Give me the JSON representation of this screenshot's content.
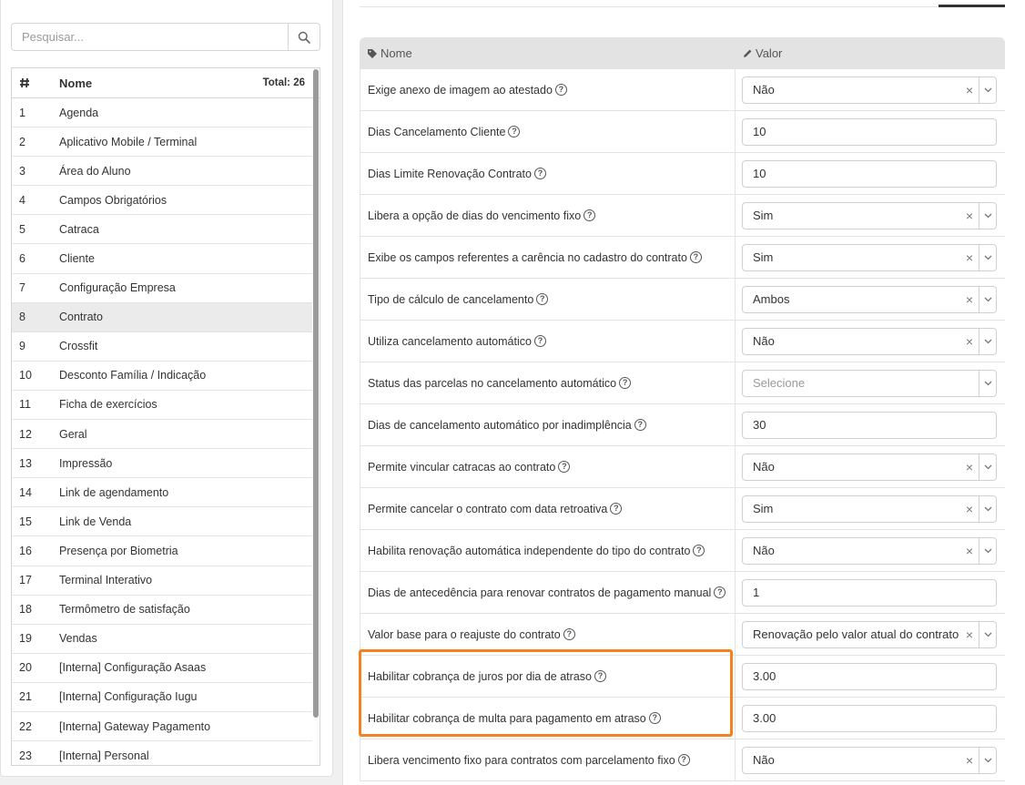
{
  "search": {
    "placeholder": "Pesquisar..."
  },
  "list": {
    "header_hash": "#",
    "header_name": "Nome",
    "total": "Total: 26",
    "items": [
      {
        "num": "1",
        "name": "Agenda"
      },
      {
        "num": "2",
        "name": "Aplicativo Mobile / Terminal"
      },
      {
        "num": "3",
        "name": "Área do Aluno"
      },
      {
        "num": "4",
        "name": "Campos Obrigatórios"
      },
      {
        "num": "5",
        "name": "Catraca"
      },
      {
        "num": "6",
        "name": "Cliente"
      },
      {
        "num": "7",
        "name": "Configuração Empresa"
      },
      {
        "num": "8",
        "name": "Contrato"
      },
      {
        "num": "9",
        "name": "Crossfit"
      },
      {
        "num": "10",
        "name": "Desconto Família / Indicação"
      },
      {
        "num": "11",
        "name": "Ficha de exercícios"
      },
      {
        "num": "12",
        "name": "Geral"
      },
      {
        "num": "13",
        "name": "Impressão"
      },
      {
        "num": "14",
        "name": "Link de agendamento"
      },
      {
        "num": "15",
        "name": "Link de Venda"
      },
      {
        "num": "16",
        "name": "Presença por Biometria"
      },
      {
        "num": "17",
        "name": "Terminal Interativo"
      },
      {
        "num": "18",
        "name": "Termômetro de satisfação"
      },
      {
        "num": "19",
        "name": "Vendas"
      },
      {
        "num": "20",
        "name": "[Interna] Configuração Asaas"
      },
      {
        "num": "21",
        "name": "[Interna] Configuração Iugu"
      },
      {
        "num": "22",
        "name": "[Interna] Gateway Pagamento"
      },
      {
        "num": "23",
        "name": "[Interna] Personal"
      }
    ],
    "selected_index": 7
  },
  "config": {
    "header_name": "Nome",
    "header_value": "Valor",
    "help_glyph": "?",
    "rows": [
      {
        "label": "Exige anexo de imagem ao atestado",
        "type": "select",
        "value": "Não"
      },
      {
        "label": "Dias Cancelamento Cliente",
        "type": "input",
        "value": "10"
      },
      {
        "label": "Dias Limite Renovação Contrato",
        "type": "input",
        "value": "10"
      },
      {
        "label": "Libera a opção de dias do vencimento fixo",
        "type": "select",
        "value": "Sim"
      },
      {
        "label": "Exibe os campos referentes a carência no cadastro do contrato",
        "type": "select",
        "value": "Sim"
      },
      {
        "label": "Tipo de cálculo de cancelamento",
        "type": "select",
        "value": "Ambos"
      },
      {
        "label": "Utiliza cancelamento automático",
        "type": "select",
        "value": "Não"
      },
      {
        "label": "Status das parcelas no cancelamento automático",
        "type": "select-empty",
        "value": "Selecione"
      },
      {
        "label": "Dias de cancelamento automático por inadimplência",
        "type": "input",
        "value": "30"
      },
      {
        "label": "Permite vincular catracas ao contrato",
        "type": "select",
        "value": "Não"
      },
      {
        "label": "Permite cancelar o contrato com data retroativa",
        "type": "select",
        "value": "Sim"
      },
      {
        "label": "Habilita renovação automática independente do tipo do contrato",
        "type": "select",
        "value": "Não"
      },
      {
        "label": "Dias de antecedência para renovar contratos de pagamento manual",
        "type": "input",
        "value": "1"
      },
      {
        "label": "Valor base para o reajuste do contrato",
        "type": "select",
        "value": "Renovação pelo valor atual do contrato"
      },
      {
        "label": "Habilitar cobrança de juros por dia de atraso",
        "type": "input",
        "value": "3.00"
      },
      {
        "label": "Habilitar cobrança de multa para pagamento em atraso",
        "type": "input",
        "value": "3.00"
      },
      {
        "label": "Libera vencimento fixo para contratos com parcelamento fixo",
        "type": "select",
        "value": "Não"
      }
    ]
  },
  "icons": {
    "search": "search-icon",
    "hash": "hashtag-icon",
    "tag": "tag-icon",
    "pencil": "pencil-icon",
    "clear": "close-icon",
    "chevron": "chevron-down-icon",
    "help": "question-circle-icon"
  },
  "colors": {
    "highlight": "#f5821f",
    "header_bg": "#e3e3e3",
    "selected_row": "#ebebeb"
  }
}
